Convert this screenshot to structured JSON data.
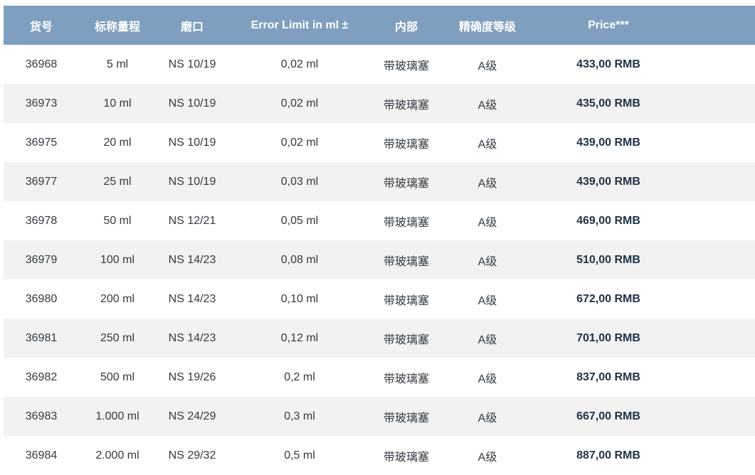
{
  "colors": {
    "header_bg": "#7e9fbf",
    "header_text": "#ffffff",
    "row_alt_bg": "#f2f2f2",
    "price_text": "#1f3247"
  },
  "table": {
    "headers": [
      "货号",
      "标称量程",
      "磨口",
      "Error Limit in ml ±",
      "内部",
      "精确度等级",
      "Price***"
    ],
    "rows": [
      [
        "36968",
        "5 ml",
        "NS 10/19",
        "0,02 ml",
        "带玻璃塞",
        "A级",
        "433,00 RMB"
      ],
      [
        "36973",
        "10 ml",
        "NS 10/19",
        "0,02 ml",
        "带玻璃塞",
        "A级",
        "435,00 RMB"
      ],
      [
        "36975",
        "20 ml",
        "NS 10/19",
        "0,02 ml",
        "带玻璃塞",
        "A级",
        "439,00 RMB"
      ],
      [
        "36977",
        "25 ml",
        "NS 10/19",
        "0,03 ml",
        "带玻璃塞",
        "A级",
        "439,00 RMB"
      ],
      [
        "36978",
        "50 ml",
        "NS 12/21",
        "0,05 ml",
        "带玻璃塞",
        "A级",
        "469,00 RMB"
      ],
      [
        "36979",
        "100 ml",
        "NS 14/23",
        "0,08 ml",
        "带玻璃塞",
        "A级",
        "510,00 RMB"
      ],
      [
        "36980",
        "200 ml",
        "NS 14/23",
        "0,10 ml",
        "带玻璃塞",
        "A级",
        "672,00 RMB"
      ],
      [
        "36981",
        "250 ml",
        "NS 14/23",
        "0,12 ml",
        "带玻璃塞",
        "A级",
        "701,00 RMB"
      ],
      [
        "36982",
        "500 ml",
        "NS 19/26",
        "0,2 ml",
        "带玻璃塞",
        "A级",
        "837,00 RMB"
      ],
      [
        "36983",
        "1.000 ml",
        "NS 24/29",
        "0,3 ml",
        "带玻璃塞",
        "A级",
        "667,00 RMB"
      ],
      [
        "36984",
        "2.000 ml",
        "NS 29/32",
        "0,5 ml",
        "带玻璃塞",
        "A级",
        "887,00 RMB"
      ]
    ]
  }
}
